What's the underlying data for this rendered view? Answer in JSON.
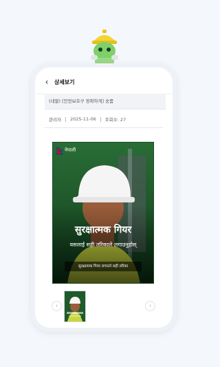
{
  "header": {
    "title": "상세보기"
  },
  "post": {
    "subject": "(네팔) [안전보호구 정확하게] 숭품",
    "author_label": "관리자",
    "date": "2025-11-06",
    "views_label": "조회수: 27"
  },
  "poster": {
    "language": "नेपाली",
    "title": "सुरक्षात्मक गियर",
    "subtitle": "यसलाई सही तरिकाले लगाउनुहोस्",
    "caption": "सुरक्षात्मक गियर लगाउने सही तरिका"
  },
  "colors": {
    "background": "#f4f7fb",
    "poster_green": "#1f5a2a",
    "flag_red": "#c8102e",
    "mascot_green": "#7fd06a",
    "helmet_yellow": "#f4d530"
  },
  "icons": [
    "back-chevron-icon",
    "chevron-left-icon",
    "chevron-right-icon",
    "nepal-flag-icon"
  ]
}
